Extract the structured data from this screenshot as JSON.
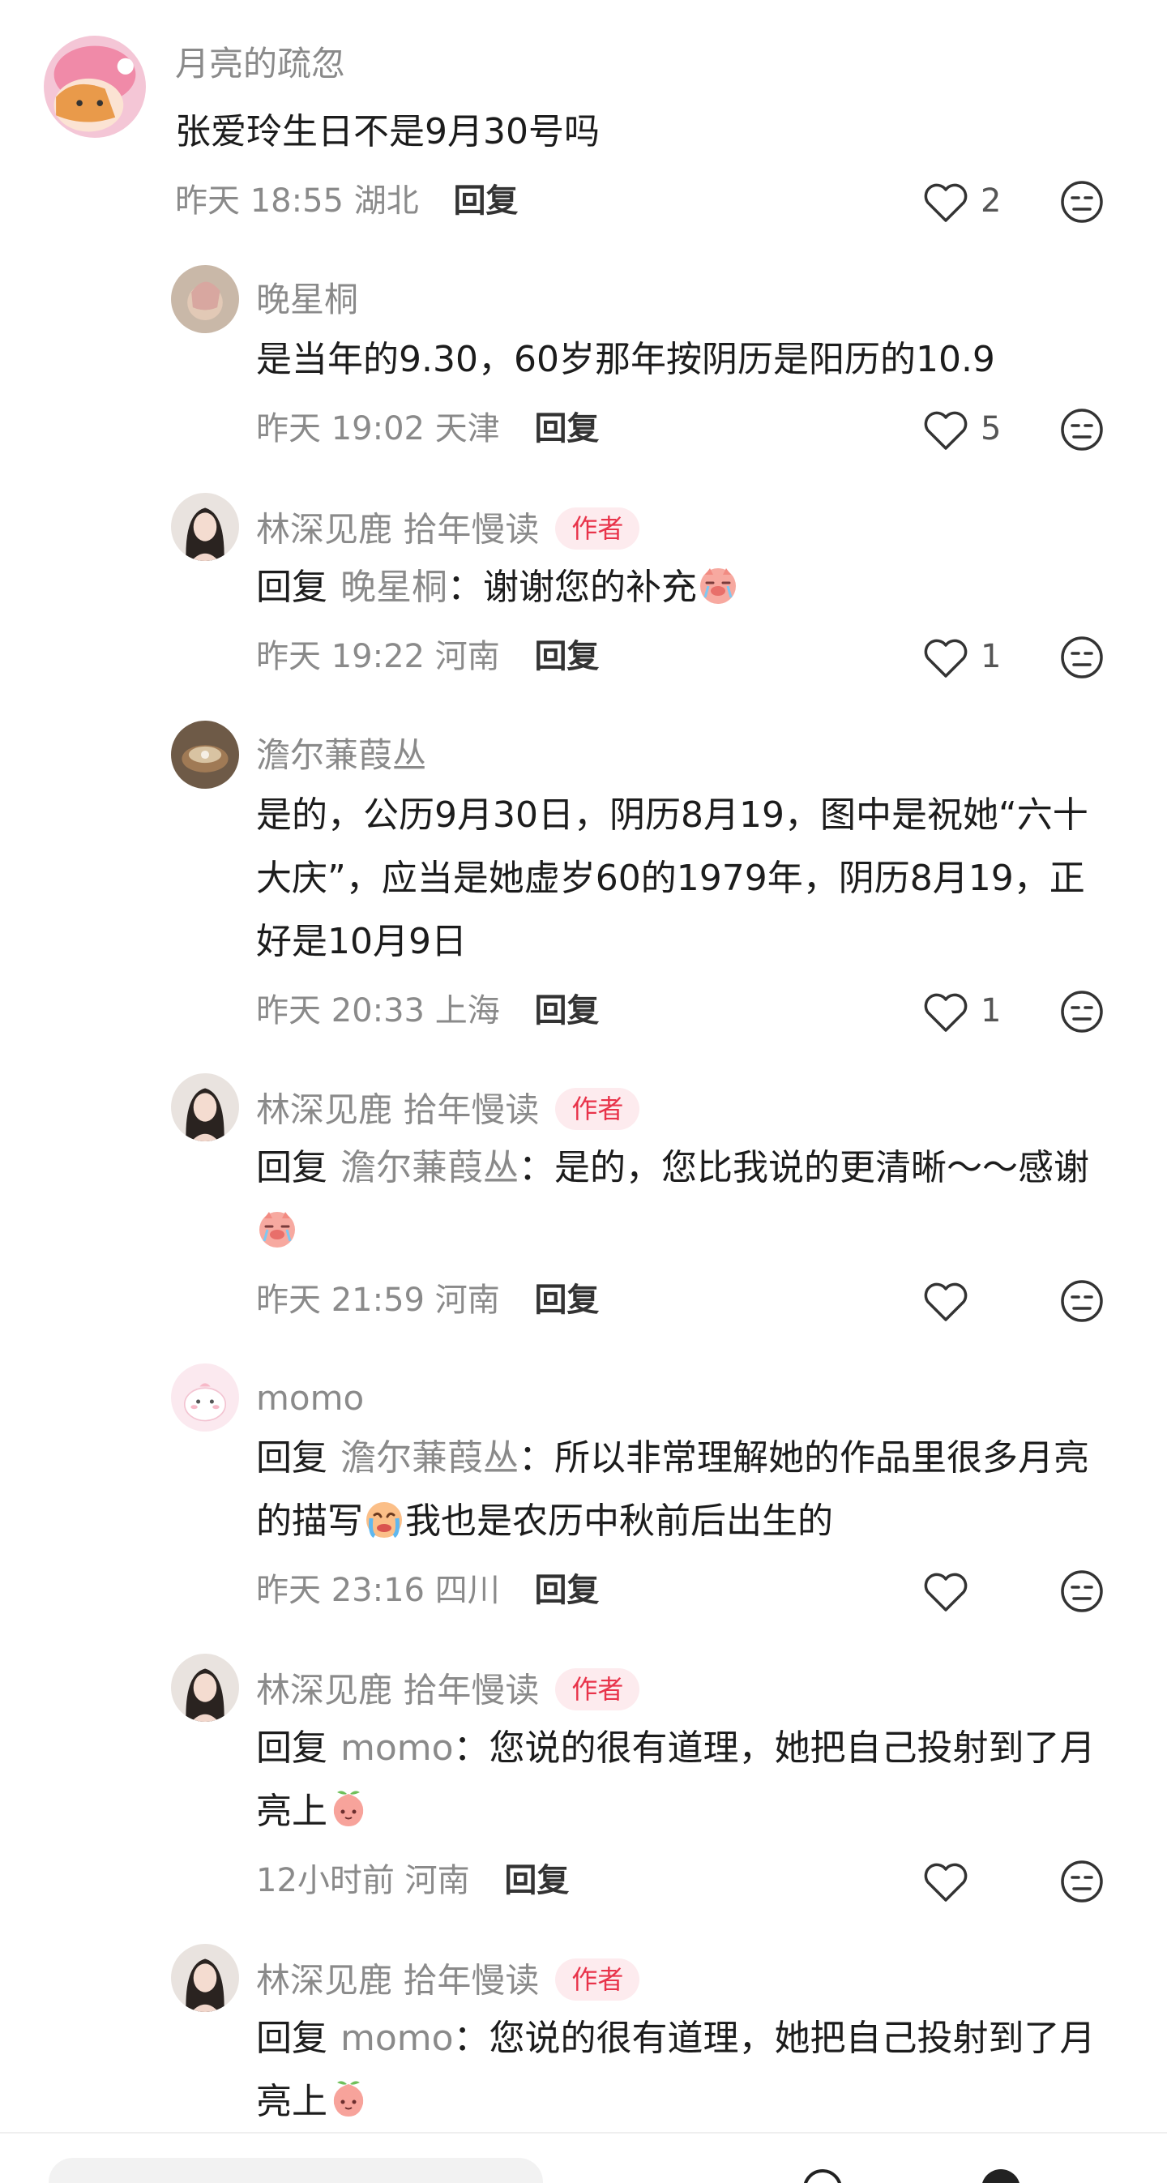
{
  "comments": [
    {
      "name": "月亮的疏忽",
      "text": "张爱玲生日不是9月30号吗",
      "time": "昨天 18:55",
      "location": "湖北",
      "reply_label": "回复",
      "likes": "2"
    },
    {
      "name": "晚星桐",
      "text": "是当年的9.30，60岁那年按阴历是阳历的10.9",
      "time": "昨天 19:02",
      "location": "天津",
      "reply_label": "回复",
      "likes": "5"
    },
    {
      "name": "林深见鹿 拾年慢读",
      "author_tag": "作者",
      "reply_prefix": "回复",
      "mention": "晚星桐",
      "text": "：谢谢您的补充",
      "emoji": "crying-pig-emoji",
      "time": "昨天 19:22",
      "location": "河南",
      "reply_label": "回复",
      "likes": "1"
    },
    {
      "name": "澹尔蒹葭丛",
      "text": "是的，公历9月30日，阴历8月19，图中是祝她“六十大庆”，应当是她虚岁60的1979年，阴历8月19，正好是10月9日",
      "time": "昨天 20:33",
      "location": "上海",
      "reply_label": "回复",
      "likes": "1"
    },
    {
      "name": "林深见鹿 拾年慢读",
      "author_tag": "作者",
      "reply_prefix": "回复",
      "mention": "澹尔蒹葭丛",
      "text": "：是的，您比我说的更清晰～～感谢",
      "emoji": "crying-pig-emoji",
      "time": "昨天 21:59",
      "location": "河南",
      "reply_label": "回复",
      "likes": ""
    },
    {
      "name": "momo",
      "reply_prefix": "回复",
      "mention": "澹尔蒹葭丛",
      "text": "：所以非常理解她的作品里很多月亮的描写",
      "emoji": "crying-face-emoji",
      "text_after": "我也是农历中秋前后出生的",
      "time": "昨天 23:16",
      "location": "四川",
      "reply_label": "回复",
      "likes": ""
    },
    {
      "name": "林深见鹿 拾年慢读",
      "author_tag": "作者",
      "reply_prefix": "回复",
      "mention": "momo",
      "text": "：您说的很有道理，她把自己投射到了月亮上",
      "emoji": "peach-face-emoji",
      "time": "12小时前",
      "location": "河南",
      "reply_label": "回复",
      "likes": ""
    },
    {
      "name": "林深见鹿 拾年慢读",
      "author_tag": "作者",
      "reply_prefix": "回复",
      "mention": "momo",
      "text": "：您说的很有道理，她把自己投射到了月亮上",
      "emoji": "peach-face-emoji"
    }
  ],
  "colors": {
    "author_tag_bg": "#fdebee",
    "author_tag_text": "#e8334a",
    "meta_text": "#8a8a8a"
  }
}
